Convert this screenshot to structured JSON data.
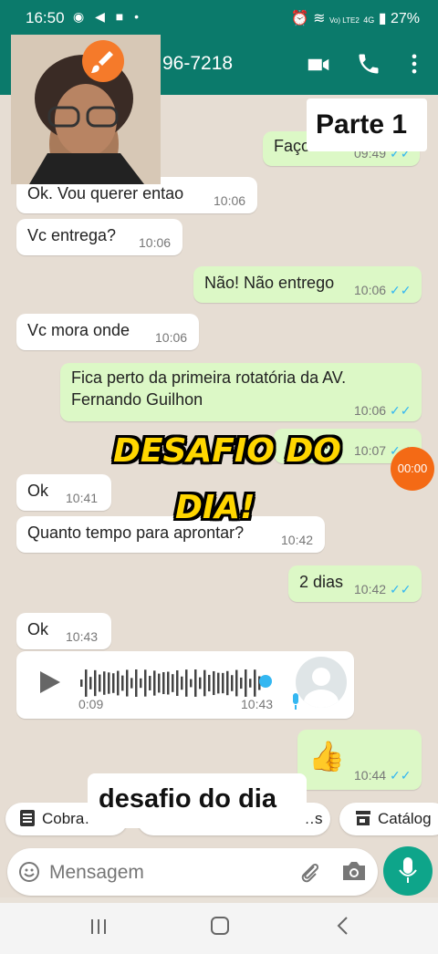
{
  "status": {
    "time": "16:50",
    "battery": "27%",
    "network": "4G",
    "carrier": "Vo) LTE2"
  },
  "header": {
    "title": "96-7218"
  },
  "video": {
    "overlay_text": "Parte 1"
  },
  "overlay": {
    "title_line1": "DESAFIO DO",
    "title_line2": "DIA!",
    "caption": "desafio do dia",
    "timer": "00:00"
  },
  "messages": [
    {
      "dir": "out",
      "text": "Faço s…",
      "time": "09:49"
    },
    {
      "dir": "in",
      "text": "Ok. Vou querer entao",
      "time": "10:06"
    },
    {
      "dir": "in",
      "text": "Vc entrega?",
      "time": "10:06"
    },
    {
      "dir": "out",
      "text": "Não! Não entrego",
      "time": "10:06"
    },
    {
      "dir": "in",
      "text": "Vc mora onde",
      "time": "10:06"
    },
    {
      "dir": "out",
      "text_line1": "Fica perto da primeira rotatória da AV.",
      "text_line2": "Fernando Guilhon",
      "time": "10:06"
    },
    {
      "dir": "out",
      "text": "ho",
      "time": "10:07"
    },
    {
      "dir": "in",
      "text": "Ok",
      "time": "10:41"
    },
    {
      "dir": "in",
      "text": "Quanto tempo para aprontar?",
      "time": "10:42"
    },
    {
      "dir": "out",
      "text": "2 dias",
      "time": "10:42"
    },
    {
      "dir": "in",
      "text": "Ok",
      "time": "10:43"
    },
    {
      "dir": "in",
      "type": "audio",
      "duration": "0:09",
      "time": "10:43",
      "progress": 1.0
    },
    {
      "dir": "out",
      "emoji": "👍",
      "time": "10:44"
    }
  ],
  "chips": [
    {
      "label": "Cobra…"
    },
    {
      "label": "…s"
    },
    {
      "label": "Catálog"
    }
  ],
  "input": {
    "placeholder": "Mensagem"
  },
  "colors": {
    "header": "#0b7a6b",
    "outgoing": "#dcf8c6",
    "incoming": "#ffffff",
    "ticks": "#34b7f1",
    "accent": "#0ea58a"
  },
  "icons": [
    "video-call-icon",
    "phone-icon",
    "more-vert-icon",
    "emoji-icon",
    "attach-icon",
    "camera-icon",
    "mic-icon",
    "brush-icon"
  ]
}
